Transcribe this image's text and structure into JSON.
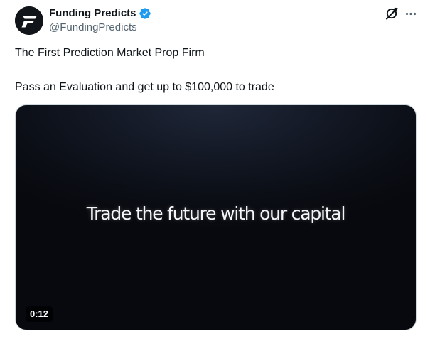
{
  "post": {
    "author": {
      "display_name": "Funding Predicts",
      "handle": "@FundingPredicts",
      "verified_icon": "verified-badge-icon",
      "avatar_icon": "funding-predicts-logo"
    },
    "actions": {
      "grok_icon": "grok-icon",
      "more_icon": "more-options-icon"
    },
    "text_lines": [
      "The First Prediction Market Prop Firm",
      "Pass an Evaluation and get up to $100,000 to trade"
    ],
    "media": {
      "type": "video",
      "caption": "Trade the future with our capital",
      "duration": "0:12"
    }
  },
  "colors": {
    "text_primary": "#0f1419",
    "text_secondary": "#536471",
    "verified_blue": "#1d9bf0",
    "border": "#cfd9de",
    "video_background": "#0b0e15"
  }
}
